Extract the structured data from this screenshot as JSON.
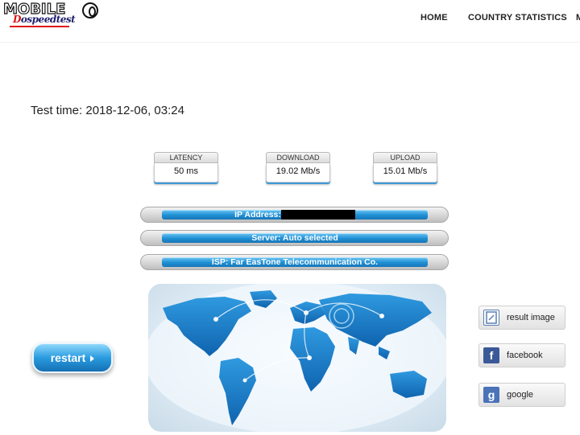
{
  "header": {
    "logo_top": "MOBILE",
    "logo_sub_d": "D",
    "logo_sub": "ospeedtest",
    "nav": [
      "HOME",
      "COUNTRY STATISTICS",
      "M"
    ]
  },
  "test_time": "Test time: 2018-12-06, 03:24",
  "metrics": {
    "latency_label": "LATENCY",
    "latency_value": "50 ms",
    "download_label": "DOWNLOAD",
    "download_value": "19.02 Mb/s",
    "upload_label": "UPLOAD",
    "upload_value": "15.01 Mb/s"
  },
  "info": {
    "ip_label": "IP Address:",
    "server": "Server: Auto selected",
    "isp": "ISP: Far EasTone Telecommunication Co."
  },
  "restart_label": "restart",
  "share": {
    "result_image": "result image",
    "facebook": "facebook",
    "google": "google",
    "facebook_icon": "f",
    "google_icon": "g"
  },
  "colors": {
    "accent_blue": "#1f8fd4",
    "facebook_blue": "#3b5998",
    "google_blue": "#4a73b8"
  },
  "icons": [
    "edit-image-icon",
    "facebook-icon",
    "google-icon",
    "chevron-right-icon",
    "world-map-graphic"
  ]
}
